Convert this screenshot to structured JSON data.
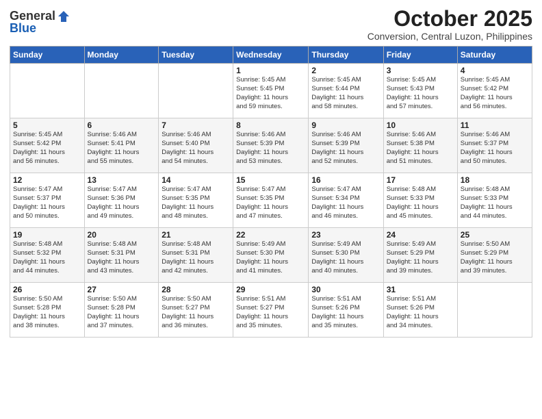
{
  "header": {
    "logo_general": "General",
    "logo_blue": "Blue",
    "title": "October 2025",
    "location": "Conversion, Central Luzon, Philippines"
  },
  "days_of_week": [
    "Sunday",
    "Monday",
    "Tuesday",
    "Wednesday",
    "Thursday",
    "Friday",
    "Saturday"
  ],
  "weeks": [
    [
      {
        "day": "",
        "info": ""
      },
      {
        "day": "",
        "info": ""
      },
      {
        "day": "",
        "info": ""
      },
      {
        "day": "1",
        "info": "Sunrise: 5:45 AM\nSunset: 5:45 PM\nDaylight: 11 hours\nand 59 minutes."
      },
      {
        "day": "2",
        "info": "Sunrise: 5:45 AM\nSunset: 5:44 PM\nDaylight: 11 hours\nand 58 minutes."
      },
      {
        "day": "3",
        "info": "Sunrise: 5:45 AM\nSunset: 5:43 PM\nDaylight: 11 hours\nand 57 minutes."
      },
      {
        "day": "4",
        "info": "Sunrise: 5:45 AM\nSunset: 5:42 PM\nDaylight: 11 hours\nand 56 minutes."
      }
    ],
    [
      {
        "day": "5",
        "info": "Sunrise: 5:45 AM\nSunset: 5:42 PM\nDaylight: 11 hours\nand 56 minutes."
      },
      {
        "day": "6",
        "info": "Sunrise: 5:46 AM\nSunset: 5:41 PM\nDaylight: 11 hours\nand 55 minutes."
      },
      {
        "day": "7",
        "info": "Sunrise: 5:46 AM\nSunset: 5:40 PM\nDaylight: 11 hours\nand 54 minutes."
      },
      {
        "day": "8",
        "info": "Sunrise: 5:46 AM\nSunset: 5:39 PM\nDaylight: 11 hours\nand 53 minutes."
      },
      {
        "day": "9",
        "info": "Sunrise: 5:46 AM\nSunset: 5:39 PM\nDaylight: 11 hours\nand 52 minutes."
      },
      {
        "day": "10",
        "info": "Sunrise: 5:46 AM\nSunset: 5:38 PM\nDaylight: 11 hours\nand 51 minutes."
      },
      {
        "day": "11",
        "info": "Sunrise: 5:46 AM\nSunset: 5:37 PM\nDaylight: 11 hours\nand 50 minutes."
      }
    ],
    [
      {
        "day": "12",
        "info": "Sunrise: 5:47 AM\nSunset: 5:37 PM\nDaylight: 11 hours\nand 50 minutes."
      },
      {
        "day": "13",
        "info": "Sunrise: 5:47 AM\nSunset: 5:36 PM\nDaylight: 11 hours\nand 49 minutes."
      },
      {
        "day": "14",
        "info": "Sunrise: 5:47 AM\nSunset: 5:35 PM\nDaylight: 11 hours\nand 48 minutes."
      },
      {
        "day": "15",
        "info": "Sunrise: 5:47 AM\nSunset: 5:35 PM\nDaylight: 11 hours\nand 47 minutes."
      },
      {
        "day": "16",
        "info": "Sunrise: 5:47 AM\nSunset: 5:34 PM\nDaylight: 11 hours\nand 46 minutes."
      },
      {
        "day": "17",
        "info": "Sunrise: 5:48 AM\nSunset: 5:33 PM\nDaylight: 11 hours\nand 45 minutes."
      },
      {
        "day": "18",
        "info": "Sunrise: 5:48 AM\nSunset: 5:33 PM\nDaylight: 11 hours\nand 44 minutes."
      }
    ],
    [
      {
        "day": "19",
        "info": "Sunrise: 5:48 AM\nSunset: 5:32 PM\nDaylight: 11 hours\nand 44 minutes."
      },
      {
        "day": "20",
        "info": "Sunrise: 5:48 AM\nSunset: 5:31 PM\nDaylight: 11 hours\nand 43 minutes."
      },
      {
        "day": "21",
        "info": "Sunrise: 5:48 AM\nSunset: 5:31 PM\nDaylight: 11 hours\nand 42 minutes."
      },
      {
        "day": "22",
        "info": "Sunrise: 5:49 AM\nSunset: 5:30 PM\nDaylight: 11 hours\nand 41 minutes."
      },
      {
        "day": "23",
        "info": "Sunrise: 5:49 AM\nSunset: 5:30 PM\nDaylight: 11 hours\nand 40 minutes."
      },
      {
        "day": "24",
        "info": "Sunrise: 5:49 AM\nSunset: 5:29 PM\nDaylight: 11 hours\nand 39 minutes."
      },
      {
        "day": "25",
        "info": "Sunrise: 5:50 AM\nSunset: 5:29 PM\nDaylight: 11 hours\nand 39 minutes."
      }
    ],
    [
      {
        "day": "26",
        "info": "Sunrise: 5:50 AM\nSunset: 5:28 PM\nDaylight: 11 hours\nand 38 minutes."
      },
      {
        "day": "27",
        "info": "Sunrise: 5:50 AM\nSunset: 5:28 PM\nDaylight: 11 hours\nand 37 minutes."
      },
      {
        "day": "28",
        "info": "Sunrise: 5:50 AM\nSunset: 5:27 PM\nDaylight: 11 hours\nand 36 minutes."
      },
      {
        "day": "29",
        "info": "Sunrise: 5:51 AM\nSunset: 5:27 PM\nDaylight: 11 hours\nand 35 minutes."
      },
      {
        "day": "30",
        "info": "Sunrise: 5:51 AM\nSunset: 5:26 PM\nDaylight: 11 hours\nand 35 minutes."
      },
      {
        "day": "31",
        "info": "Sunrise: 5:51 AM\nSunset: 5:26 PM\nDaylight: 11 hours\nand 34 minutes."
      },
      {
        "day": "",
        "info": ""
      }
    ]
  ]
}
